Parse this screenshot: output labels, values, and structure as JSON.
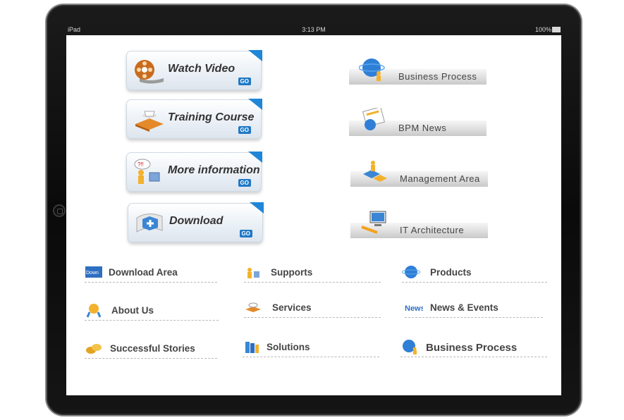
{
  "status_bar": {
    "device": "iPad",
    "time": "3:13 PM",
    "battery": "100%"
  },
  "go_buttons": [
    {
      "label": "Watch Video",
      "go": "GO",
      "icon": "film-reel-icon"
    },
    {
      "label": "Training Course",
      "go": "GO",
      "icon": "book-coffee-icon"
    },
    {
      "label": "More information",
      "go": "GO",
      "icon": "question-person-icon"
    },
    {
      "label": "Download",
      "go": "GO",
      "icon": "download-scroll-icon"
    }
  ],
  "banners": [
    {
      "label": "Business Process",
      "icon": "globe-people-icon"
    },
    {
      "label": "BPM  News",
      "icon": "newspaper-globe-icon"
    },
    {
      "label": "Management  Area",
      "icon": "blocks-people-icon"
    },
    {
      "label": "IT Architecture",
      "icon": "computer-tools-icon"
    }
  ],
  "links": [
    {
      "label": "Download Area",
      "icon": "download-box-icon"
    },
    {
      "label": "Supports",
      "icon": "support-people-icon"
    },
    {
      "label": "Products",
      "icon": "globe-icon"
    },
    {
      "label": "About Us",
      "icon": "award-icon"
    },
    {
      "label": "Services",
      "icon": "service-tray-icon"
    },
    {
      "label": "News & Events",
      "icon": "news-icon"
    },
    {
      "label": "Successful Stories",
      "icon": "coins-icon"
    },
    {
      "label": "Solutions",
      "icon": "books-icon"
    },
    {
      "label": "Business Process",
      "icon": "globe-person-icon"
    }
  ]
}
